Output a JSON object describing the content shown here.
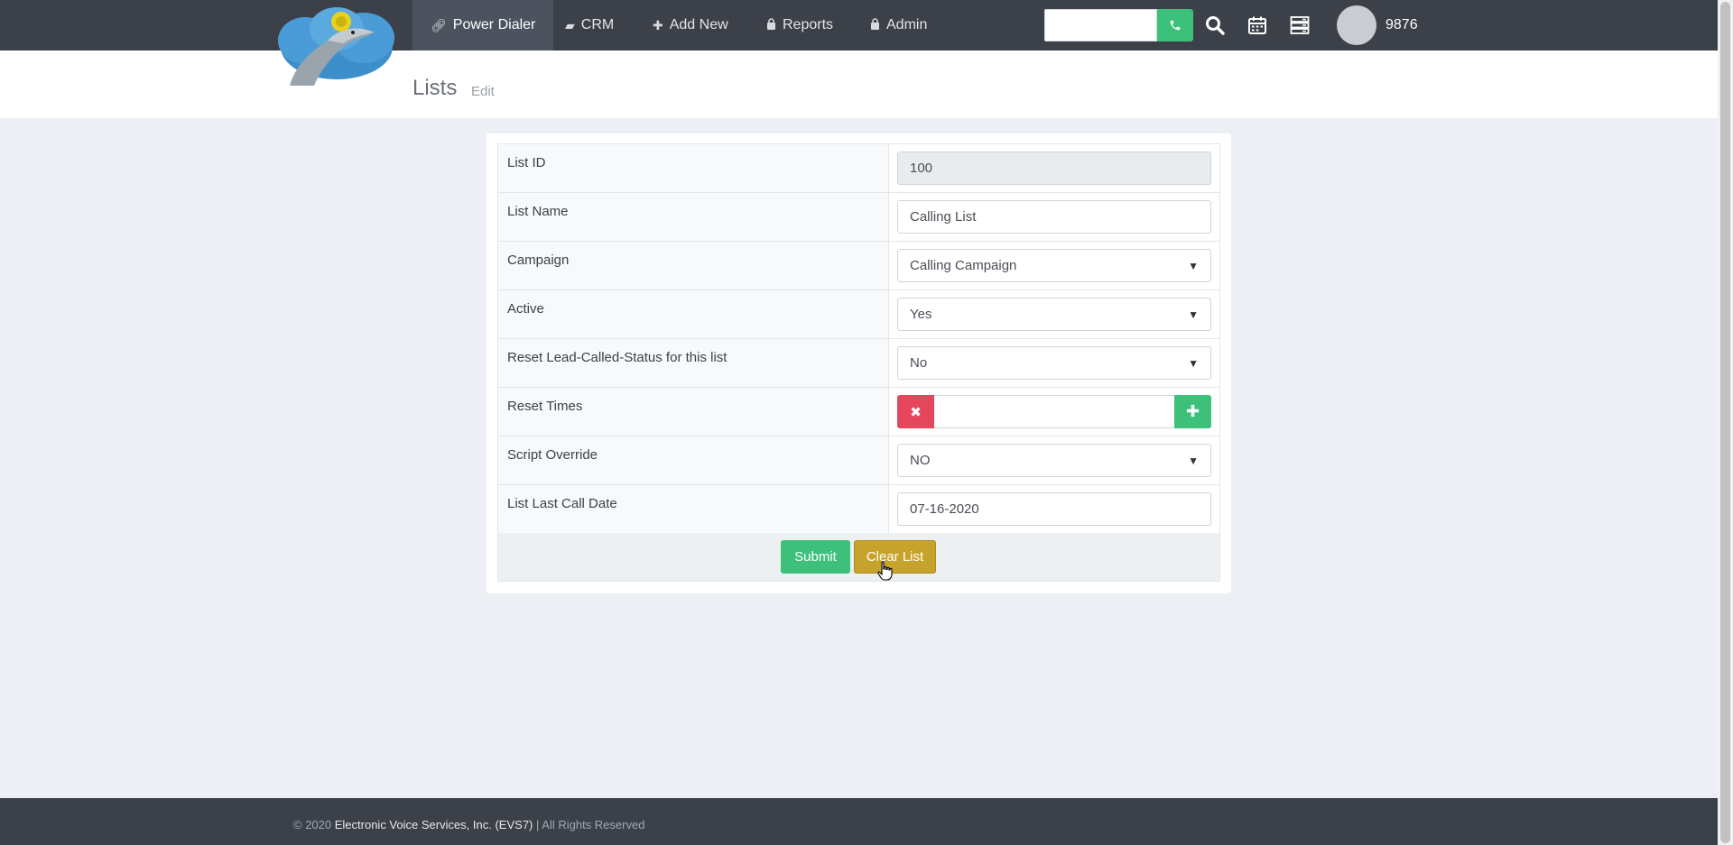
{
  "nav": {
    "items": [
      {
        "label": "Power Dialer",
        "icon": "link-icon"
      },
      {
        "label": "CRM",
        "icon": "book-icon"
      },
      {
        "label": "Add New",
        "icon": "plus-icon"
      },
      {
        "label": "Reports",
        "icon": "lock-icon"
      },
      {
        "label": "Admin",
        "icon": "lock-icon"
      }
    ],
    "extension": "9876"
  },
  "page": {
    "title": "Lists",
    "subtitle": "Edit"
  },
  "form": {
    "rows": [
      {
        "label": "List ID",
        "value": "100"
      },
      {
        "label": "List Name",
        "value": "Calling List"
      },
      {
        "label": "Campaign",
        "value": "Calling Campaign"
      },
      {
        "label": "Active",
        "value": "Yes"
      },
      {
        "label": "Reset Lead-Called-Status for this list",
        "value": "No"
      },
      {
        "label": "Reset Times",
        "value": ""
      },
      {
        "label": "Script Override",
        "value": "NO"
      },
      {
        "label": "List Last Call Date",
        "value": "07-16-2020"
      }
    ],
    "submit_label": "Submit",
    "clear_label": "Clear List"
  },
  "footer": {
    "prefix": "© 2020 ",
    "company": "Electronic Voice Services, Inc. (EVS7)",
    "suffix": " | All Rights Reserved"
  },
  "colors": {
    "nav_bg": "#3b4049",
    "success": "#3cc07a",
    "danger": "#e5465b",
    "warning": "#c8a32c"
  }
}
